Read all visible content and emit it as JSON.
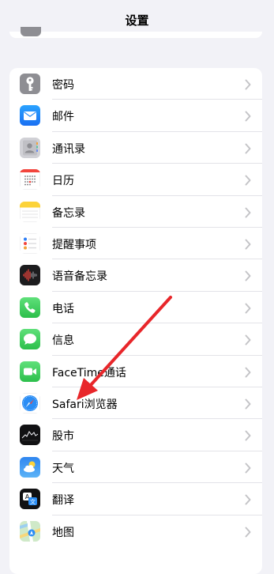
{
  "header": {
    "title": "设置"
  },
  "items": [
    {
      "label": "密码",
      "icon": "key-icon"
    },
    {
      "label": "邮件",
      "icon": "mail-icon"
    },
    {
      "label": "通讯录",
      "icon": "contacts-icon"
    },
    {
      "label": "日历",
      "icon": "calendar-icon"
    },
    {
      "label": "备忘录",
      "icon": "notes-icon"
    },
    {
      "label": "提醒事项",
      "icon": "reminders-icon"
    },
    {
      "label": "语音备忘录",
      "icon": "voice-memos-icon"
    },
    {
      "label": "电话",
      "icon": "phone-icon"
    },
    {
      "label": "信息",
      "icon": "messages-icon"
    },
    {
      "label": "FaceTime通话",
      "icon": "facetime-icon"
    },
    {
      "label": "Safari浏览器",
      "icon": "safari-icon"
    },
    {
      "label": "股市",
      "icon": "stocks-icon"
    },
    {
      "label": "天气",
      "icon": "weather-icon"
    },
    {
      "label": "翻译",
      "icon": "translate-icon"
    },
    {
      "label": "地图",
      "icon": "maps-icon"
    }
  ],
  "colors": {
    "background": "#f2f2f7",
    "annotation_arrow": "#e8262a",
    "chevron": "#c4c4c7"
  }
}
